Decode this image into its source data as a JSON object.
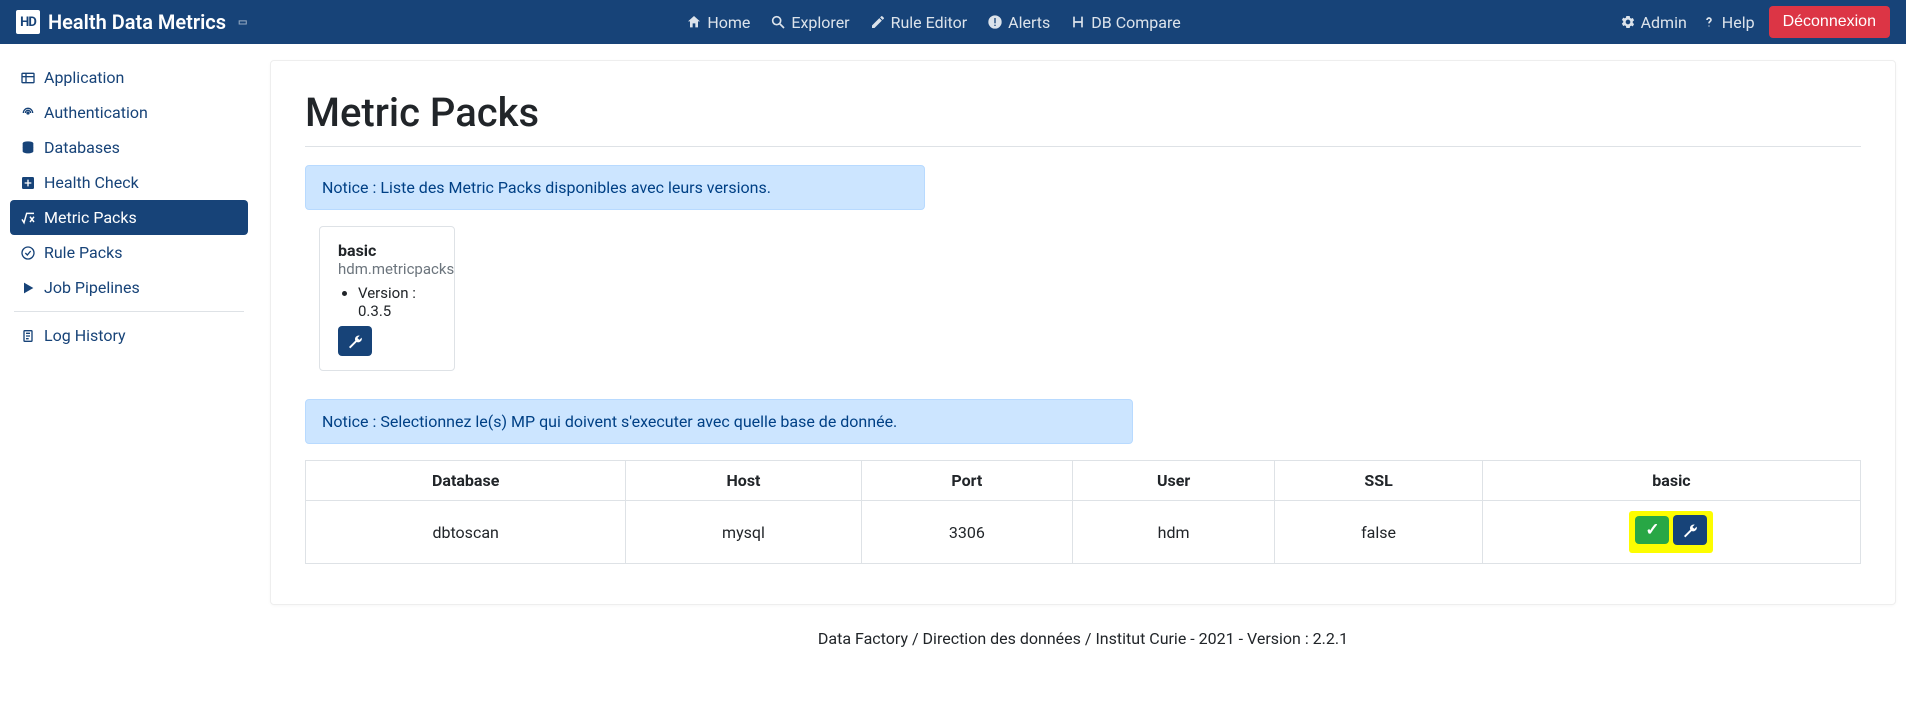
{
  "app_title": "Health Data Metrics",
  "nav": {
    "home": "Home",
    "explorer": "Explorer",
    "rule_editor": "Rule Editor",
    "alerts": "Alerts",
    "db_compare": "DB Compare",
    "admin": "Admin",
    "help": "Help",
    "logout": "Déconnexion"
  },
  "sidebar": {
    "application": "Application",
    "authentication": "Authentication",
    "databases": "Databases",
    "health_check": "Health Check",
    "metric_packs": "Metric Packs",
    "rule_packs": "Rule Packs",
    "job_pipelines": "Job Pipelines",
    "log_history": "Log History"
  },
  "page": {
    "title": "Metric Packs",
    "notice1": "Notice : Liste des Metric Packs disponibles avec leurs versions.",
    "notice2": "Notice : Selectionnez le(s) MP qui doivent s'executer avec quelle base de donnée."
  },
  "pack": {
    "name": "basic",
    "module": "hdm.metricpacks",
    "version_label": "Version : 0.3.5"
  },
  "table": {
    "headers": {
      "database": "Database",
      "host": "Host",
      "port": "Port",
      "user": "User",
      "ssl": "SSL",
      "basic": "basic"
    },
    "row": {
      "database": "dbtoscan",
      "host": "mysql",
      "port": "3306",
      "user": "hdm",
      "ssl": "false"
    }
  },
  "footer": "Data Factory / Direction des données / Institut Curie - 2021 - Version : 2.2.1"
}
